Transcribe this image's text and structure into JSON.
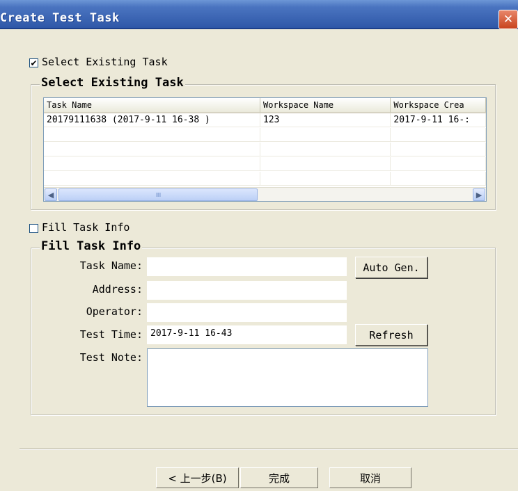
{
  "window": {
    "title": "Create Test Task",
    "close_glyph": "✕"
  },
  "select_existing": {
    "checkbox_label": "Select Existing Task",
    "checked": true,
    "check_glyph": "✔",
    "group_label": "Select Existing Task",
    "columns": [
      "Task Name",
      "Workspace Name",
      "Workspace Crea"
    ],
    "rows": [
      [
        "20179111638 (2017-9-11  16-38 )",
        "123",
        "2017-9-11  16-:"
      ]
    ],
    "scroll_left_glyph": "◀",
    "scroll_right_glyph": "▶",
    "thumb_grip": "IIIII"
  },
  "fill_info": {
    "checkbox_label": "Fill Task Info",
    "checked": false,
    "group_label": "Fill Task Info",
    "task_name_label": "Task Name:",
    "address_label": "Address:",
    "operator_label": "Operator:",
    "test_time_label": "Test Time:",
    "test_note_label": "Test Note:",
    "task_name_value": "",
    "address_value": "",
    "operator_value": "",
    "test_time_value": "2017-9-11  16-43",
    "test_note_value": "",
    "auto_gen_label": "Auto Gen.",
    "refresh_label": "Refresh"
  },
  "footer": {
    "back_label": "< 上一步(B)",
    "finish_label": "完成",
    "cancel_label": "取消"
  },
  "icons": {
    "close": "close-icon",
    "scroll_left": "scroll-left-icon",
    "scroll_right": "scroll-right-icon"
  }
}
